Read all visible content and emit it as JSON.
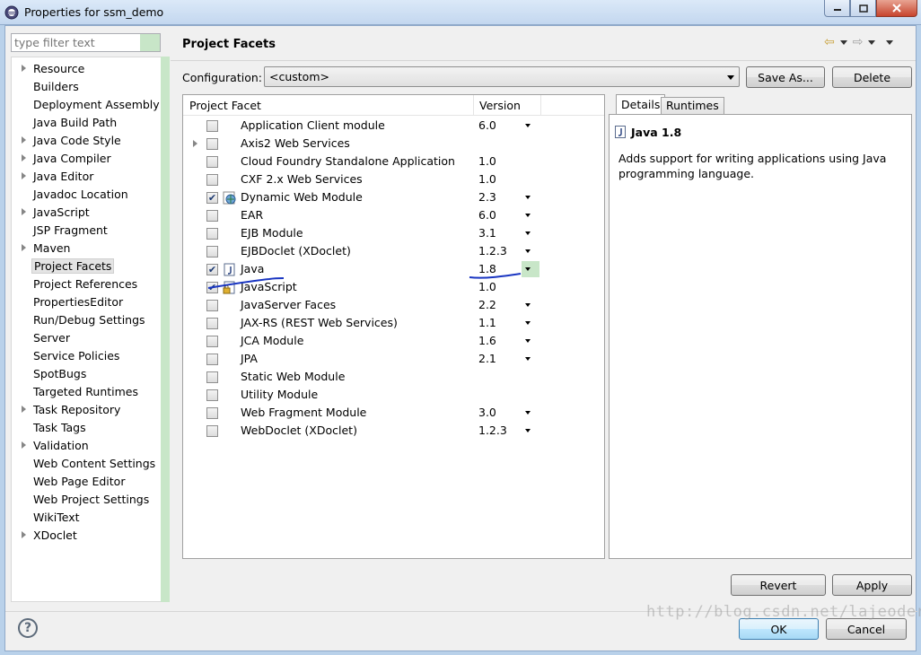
{
  "window": {
    "title": "Properties for ssm_demo"
  },
  "filter": {
    "placeholder": "type filter text"
  },
  "nav": {
    "items": [
      {
        "label": "Resource",
        "expandable": true
      },
      {
        "label": "Builders",
        "expandable": false
      },
      {
        "label": "Deployment Assembly",
        "expandable": false
      },
      {
        "label": "Java Build Path",
        "expandable": false
      },
      {
        "label": "Java Code Style",
        "expandable": true
      },
      {
        "label": "Java Compiler",
        "expandable": true
      },
      {
        "label": "Java Editor",
        "expandable": true
      },
      {
        "label": "Javadoc Location",
        "expandable": false
      },
      {
        "label": "JavaScript",
        "expandable": true
      },
      {
        "label": "JSP Fragment",
        "expandable": false
      },
      {
        "label": "Maven",
        "expandable": true
      },
      {
        "label": "Project Facets",
        "expandable": false,
        "selected": true
      },
      {
        "label": "Project References",
        "expandable": false
      },
      {
        "label": "PropertiesEditor",
        "expandable": false
      },
      {
        "label": "Run/Debug Settings",
        "expandable": false
      },
      {
        "label": "Server",
        "expandable": false
      },
      {
        "label": "Service Policies",
        "expandable": false
      },
      {
        "label": "SpotBugs",
        "expandable": false
      },
      {
        "label": "Targeted Runtimes",
        "expandable": false
      },
      {
        "label": "Task Repository",
        "expandable": true
      },
      {
        "label": "Task Tags",
        "expandable": false
      },
      {
        "label": "Validation",
        "expandable": true
      },
      {
        "label": "Web Content Settings",
        "expandable": false
      },
      {
        "label": "Web Page Editor",
        "expandable": false
      },
      {
        "label": "Web Project Settings",
        "expandable": false
      },
      {
        "label": "WikiText",
        "expandable": false
      },
      {
        "label": "XDoclet",
        "expandable": true
      }
    ]
  },
  "page": {
    "title": "Project Facets"
  },
  "config": {
    "label": "Configuration:",
    "value": "<custom>",
    "save_as": "Save As...",
    "delete": "Delete"
  },
  "facets": {
    "col_facet": "Project Facet",
    "col_version": "Version",
    "rows": [
      {
        "name": "Application Client module",
        "version": "6.0",
        "checked": false,
        "dropdown": true,
        "icon": "none"
      },
      {
        "name": "Axis2 Web Services",
        "version": "",
        "checked": false,
        "dropdown": false,
        "expandable": true,
        "icon": "none"
      },
      {
        "name": "Cloud Foundry Standalone Application",
        "version": "1.0",
        "checked": false,
        "dropdown": false,
        "icon": "none"
      },
      {
        "name": "CXF 2.x Web Services",
        "version": "1.0",
        "checked": false,
        "dropdown": false,
        "icon": "none"
      },
      {
        "name": "Dynamic Web Module",
        "version": "2.3",
        "checked": true,
        "dropdown": true,
        "icon": "globe-icon"
      },
      {
        "name": "EAR",
        "version": "6.0",
        "checked": false,
        "dropdown": true,
        "icon": "none"
      },
      {
        "name": "EJB Module",
        "version": "3.1",
        "checked": false,
        "dropdown": true,
        "icon": "none"
      },
      {
        "name": "EJBDoclet (XDoclet)",
        "version": "1.2.3",
        "checked": false,
        "dropdown": true,
        "icon": "none"
      },
      {
        "name": "Java",
        "version": "1.8",
        "checked": true,
        "dropdown": true,
        "icon": "java-file-icon",
        "highlight_dropdown": true
      },
      {
        "name": "JavaScript",
        "version": "1.0",
        "checked": true,
        "dropdown": false,
        "icon": "javascript-lock-icon"
      },
      {
        "name": "JavaServer Faces",
        "version": "2.2",
        "checked": false,
        "dropdown": true,
        "icon": "none"
      },
      {
        "name": "JAX-RS (REST Web Services)",
        "version": "1.1",
        "checked": false,
        "dropdown": true,
        "icon": "none"
      },
      {
        "name": "JCA Module",
        "version": "1.6",
        "checked": false,
        "dropdown": true,
        "icon": "none"
      },
      {
        "name": "JPA",
        "version": "2.1",
        "checked": false,
        "dropdown": true,
        "icon": "none"
      },
      {
        "name": "Static Web Module",
        "version": "",
        "checked": false,
        "dropdown": false,
        "icon": "none"
      },
      {
        "name": "Utility Module",
        "version": "",
        "checked": false,
        "dropdown": false,
        "icon": "none"
      },
      {
        "name": "Web Fragment Module",
        "version": "3.0",
        "checked": false,
        "dropdown": true,
        "icon": "none"
      },
      {
        "name": "WebDoclet (XDoclet)",
        "version": "1.2.3",
        "checked": false,
        "dropdown": true,
        "icon": "none"
      }
    ]
  },
  "details": {
    "tabs": [
      "Details",
      "Runtimes"
    ],
    "title": "Java 1.8",
    "description": "Adds support for writing applications using Java programming language."
  },
  "buttons": {
    "revert": "Revert",
    "apply": "Apply",
    "ok": "OK",
    "cancel": "Cancel"
  },
  "watermark": "http://blog.csdn.net/lajeoder"
}
